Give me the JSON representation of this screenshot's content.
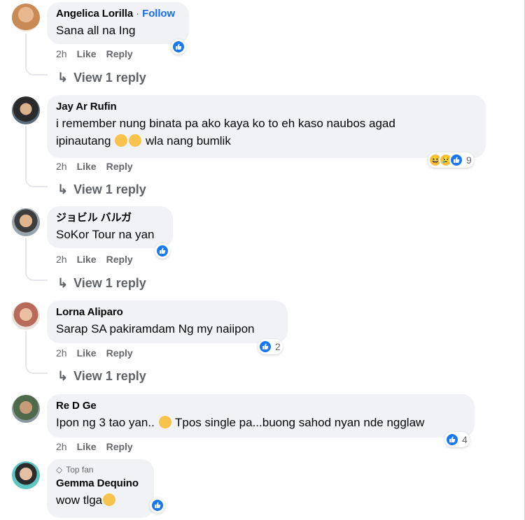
{
  "comments": [
    {
      "name": "Angelica Lorilla",
      "follow": "Follow",
      "text": "Sana all na Ing",
      "time": "2h",
      "like": "Like",
      "reply": "Reply",
      "view_reply": "View 1 reply",
      "reaction_count": ""
    },
    {
      "name": "Jay Ar Rufin",
      "text_line1": "i remember nung binata pa ako kaya ko to eh kaso naubos agad",
      "text_line2": "wla nang bumlik",
      "text_line2_pre": "ipinautang",
      "time": "2h",
      "like": "Like",
      "reply": "Reply",
      "view_reply": "View 1 reply",
      "reaction_count": "9"
    },
    {
      "name": "ジョビル バルガ",
      "text": "SoKor Tour na yan",
      "time": "2h",
      "like": "Like",
      "reply": "Reply",
      "view_reply": "View 1 reply",
      "reaction_count": ""
    },
    {
      "name": "Lorna Aliparo",
      "text": "Sarap SA pakiramdam Ng my naiipon",
      "time": "2h",
      "like": "Like",
      "reply": "Reply",
      "view_reply": "View 1 reply",
      "reaction_count": "2"
    },
    {
      "name": "Re D Ge",
      "text_pre": "Ipon ng 3 tao yan..",
      "text_post": "Tpos single pa...buong sahod nyan nde ngglaw",
      "time": "2h",
      "like": "Like",
      "reply": "Reply",
      "reaction_count": "4"
    },
    {
      "badge": "Top fan",
      "name": "Gemma Dequino",
      "text": "wow tlga",
      "reaction_count": ""
    }
  ],
  "colors": {
    "like_blue": "#1877f2",
    "follow_blue": "#1a6fe0",
    "bubble": "#f0f2f5",
    "meta": "#65676b"
  },
  "icons": {
    "reply_arrow": "reply-arrow-icon",
    "like": "like-reaction-icon",
    "haha": "haha-reaction-icon",
    "sad": "sad-reaction-icon",
    "top_fan": "diamond-badge-icon"
  }
}
